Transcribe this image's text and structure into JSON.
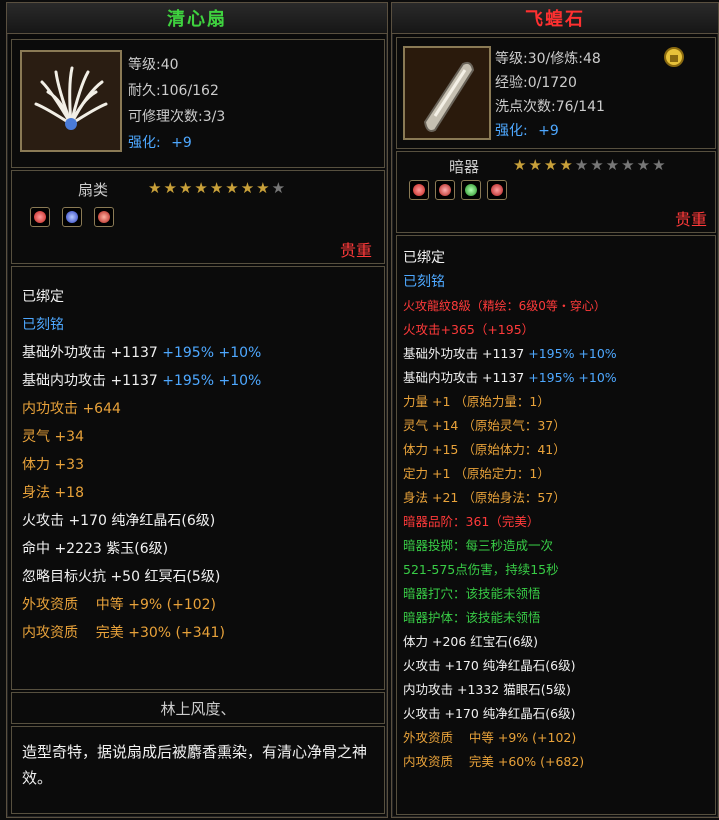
{
  "left": {
    "title": "清心扇",
    "level": "等级:40",
    "durability": "耐久:106/162",
    "repair": "可修理次数:3/3",
    "enhance_label": "强化:",
    "enhance_value": "+9",
    "type": "扇类",
    "stars_filled": 8,
    "stars_total": 9,
    "rarity": "贵重",
    "bound": "已绑定",
    "engraved": "已刻铭",
    "attrs": [
      {
        "a": "基础外功攻击 +1137 ",
        "b": "+195% +10%"
      },
      {
        "a": "基础内功攻击 +1137 ",
        "b": "+195% +10%"
      }
    ],
    "bonus": [
      "内功攻击 +644",
      "灵气 +34",
      "体力 +33",
      "身法 +18"
    ],
    "gems": [
      "火攻击 +170 纯净红晶石(6级)",
      "命中 +2223 紫玉(6级)",
      "忽略目标火抗 +50 红冥石(5级)"
    ],
    "quality": [
      "外攻资质    中等 +9% (+102)",
      "内攻资质    完美 +30% (+341)"
    ],
    "engraving_name": "林上风度、",
    "description": "造型奇特，据说扇成后被麝香熏染，有清心净骨之神效。"
  },
  "right": {
    "title": "飞蝗石",
    "level": "等级:30/修炼:48",
    "exp": "经验:0/1720",
    "wash": "洗点次数:76/141",
    "enhance_label": "强化:",
    "enhance_value": "+9",
    "type": "暗器",
    "stars_filled": 4,
    "stars_total": 10,
    "rarity": "贵重",
    "bound": "已绑定",
    "engraved": "已刻铭",
    "red_lines": [
      "火攻龍紋8級（精绘：6级0等・穿心）",
      "火攻击+365（+195）"
    ],
    "attrs": [
      {
        "a": "基础外功攻击 +1137 ",
        "b": "+195% +10%"
      },
      {
        "a": "基础内功攻击 +1137 ",
        "b": "+195% +10%"
      }
    ],
    "bonus": [
      "力量 +1 （原始力量：1）",
      "灵气 +14 （原始灵气：37）",
      "体力 +15 （原始体力：41）",
      "定力 +1 （原始定力：1）",
      "身法 +21 （原始身法：57）"
    ],
    "rank": "暗器品阶：361（完美）",
    "skill_lines": [
      "暗器投掷：每三秒造成一次",
      "521-575点伤害，持续15秒",
      "暗器打穴：该技能未领悟",
      "暗器护体：该技能未领悟"
    ],
    "gems": [
      "体力 +206 红宝石(6级)",
      "火攻击 +170 纯净红晶石(6级)",
      "内功攻击 +1332 猫眼石(5级)",
      "火攻击 +170 纯净红晶石(6级)"
    ],
    "quality": [
      "外攻资质    中等 +9% (+102)",
      "内攻资质    完美 +60% (+682)"
    ]
  },
  "colors": {
    "gold": "#c9a13a",
    "blue": "#4ea8ff",
    "orange": "#e8a23a",
    "red": "#ff3a3a",
    "green": "#38cc46"
  }
}
